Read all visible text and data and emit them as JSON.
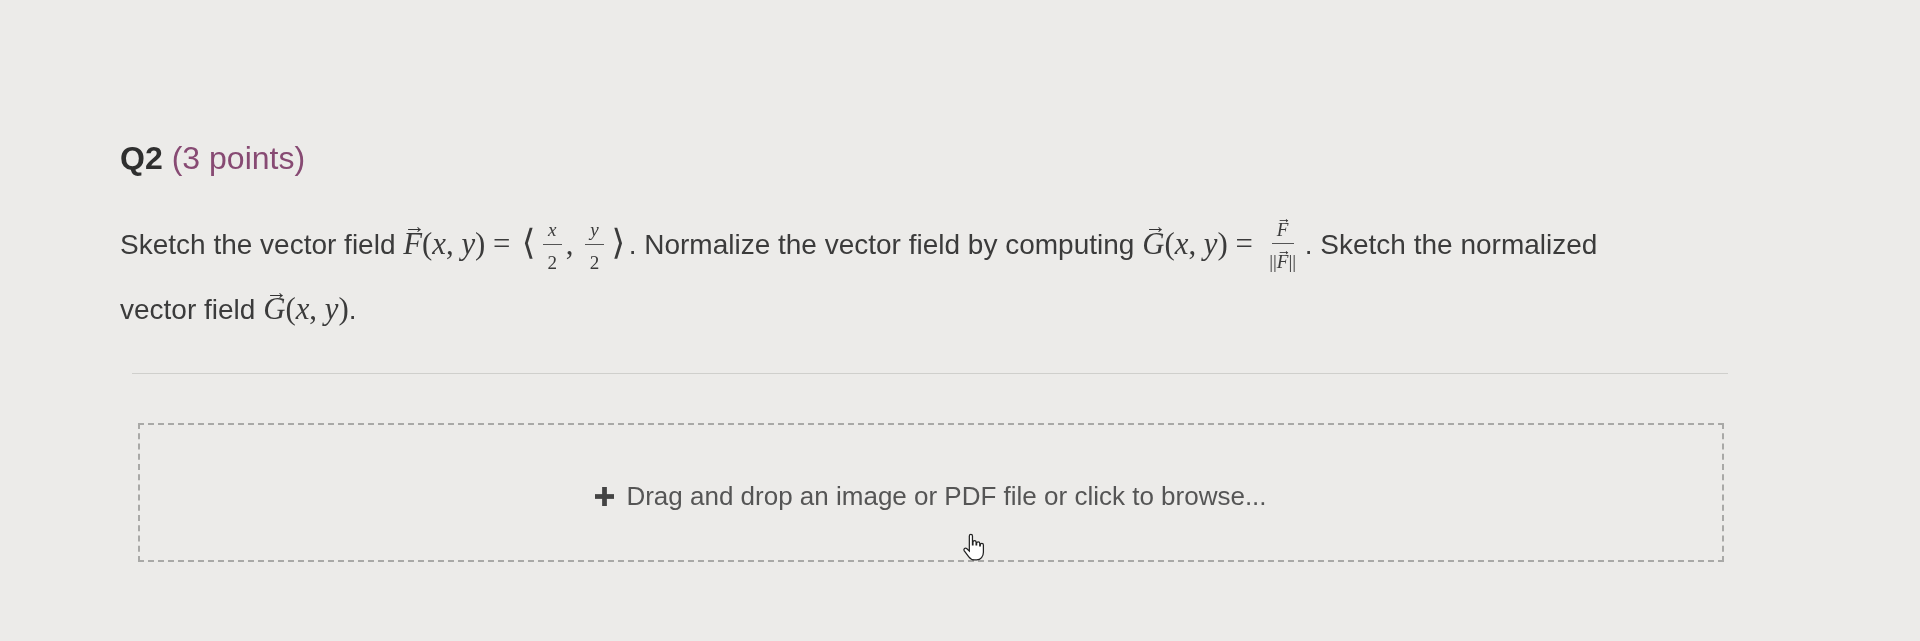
{
  "question": {
    "number": "Q2",
    "points": "(3 points)"
  },
  "prompt": [
    {
      "kind": "text",
      "text": "Sketch the vector field "
    },
    {
      "kind": "vector",
      "symbol": "F",
      "arrow": "→"
    },
    {
      "kind": "math",
      "text": "(*x*, *y*) = "
    },
    {
      "kind": "delimiter",
      "text": "⟨"
    },
    {
      "kind": "fraction",
      "numerator": [
        {
          "kind": "math",
          "text": "*x*"
        }
      ],
      "denominator": [
        {
          "kind": "math",
          "text": "2"
        }
      ]
    },
    {
      "kind": "math",
      "text": ", "
    },
    {
      "kind": "fraction",
      "numerator": [
        {
          "kind": "math",
          "text": "*y*"
        }
      ],
      "denominator": [
        {
          "kind": "math",
          "text": "2"
        }
      ]
    },
    {
      "kind": "delimiter",
      "text": "⟩"
    },
    {
      "kind": "text",
      "text": ". Normalize the vector field by computing "
    },
    {
      "kind": "vector",
      "symbol": "G",
      "arrow": "→"
    },
    {
      "kind": "math",
      "text": "(*x*, *y*) = "
    },
    {
      "kind": "fraction",
      "numerator": [
        {
          "kind": "vector",
          "symbol": "F",
          "arrow": "→"
        }
      ],
      "denominator": [
        {
          "kind": "math",
          "text": "||"
        },
        {
          "kind": "vector",
          "symbol": "F",
          "arrow": "→"
        },
        {
          "kind": "math",
          "text": "||"
        }
      ]
    },
    {
      "kind": "text",
      "text": ". Sketch the normalized vector field "
    },
    {
      "kind": "vector",
      "symbol": "G",
      "arrow": "→"
    },
    {
      "kind": "math",
      "text": "(*x*, *y*)"
    },
    {
      "kind": "text",
      "text": "."
    }
  ],
  "upload": {
    "label": "Drag and drop an image or PDF file or click to browse..."
  }
}
